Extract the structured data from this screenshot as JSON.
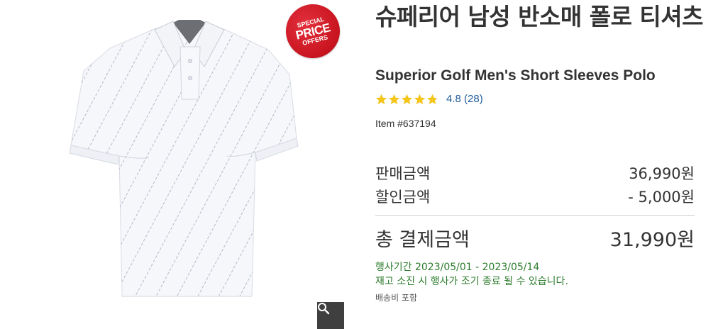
{
  "product": {
    "title_ko": "슈페리어 남성 반소매 폴로 티셔츠",
    "title_en": "Superior Golf Men's Short Sleeves Polo",
    "rating": {
      "value": 4.8,
      "stars": 5,
      "text": "4.8 (28)"
    },
    "item_number": "Item #637194"
  },
  "badge": {
    "line1": "SPECIAL",
    "line2": "PRICE",
    "line3": "OFFERS"
  },
  "pricing": {
    "sale_label": "판매금액",
    "sale_value": "36,990원",
    "discount_label": "할인금액",
    "discount_value": "- 5,000원",
    "total_label": "총 결제금액",
    "total_value": "31,990원"
  },
  "promo": {
    "period": "행사기간 2023/05/01 - 2023/05/14",
    "note": "재고 소진 시 행사가 조기 종료 될 수 있습니다."
  },
  "shipping": "배송비 포함",
  "icons": {
    "zoom": "magnifier-icon",
    "star": "star-icon"
  },
  "colors": {
    "badge": "#c8141f",
    "link": "#1f5c9a",
    "promo": "#2e7d2e",
    "star": "#f5c518"
  }
}
